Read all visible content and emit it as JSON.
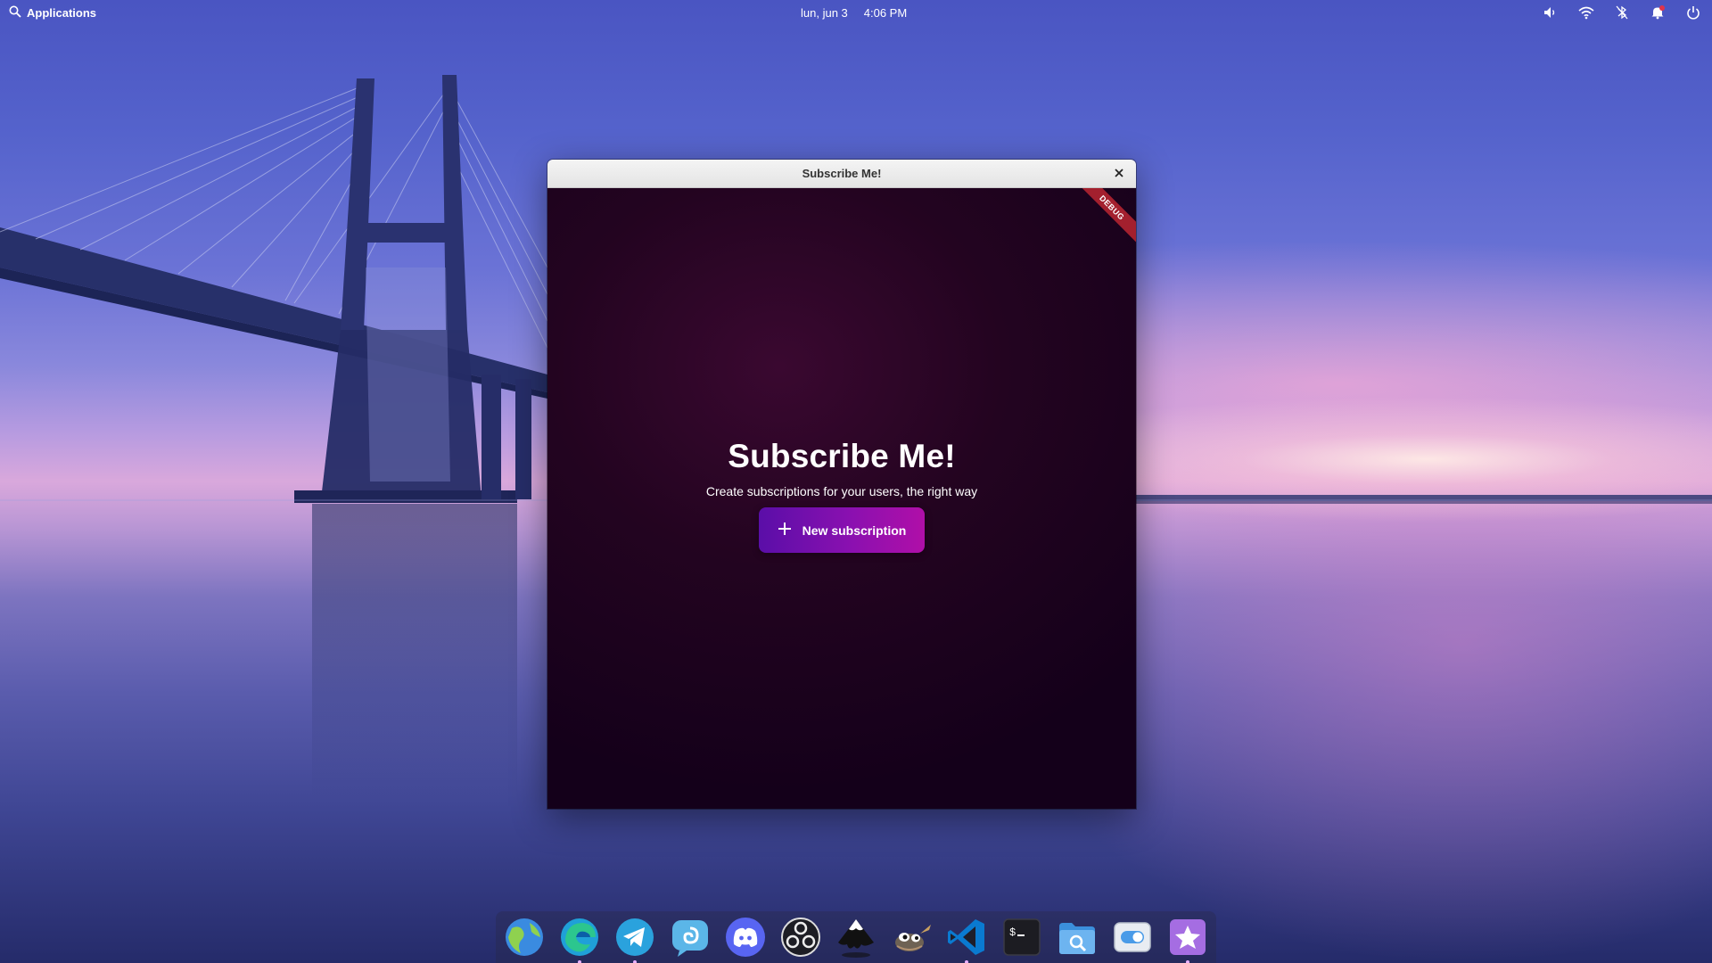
{
  "topbar": {
    "applications_label": "Applications",
    "date": "lun, jun 3",
    "time": "4:06 PM",
    "tray_icons": [
      "volume-icon",
      "wifi-icon",
      "bluetooth-off-icon",
      "notifications-icon",
      "power-icon"
    ]
  },
  "window": {
    "title": "Subscribe Me!",
    "debug_banner": "DEBUG",
    "heading": "Subscribe Me!",
    "subtitle": "Create subscriptions for your users, the right way",
    "new_button_label": "New subscription"
  },
  "dock": {
    "apps": [
      "Web",
      "Microsoft Edge",
      "Telegram",
      "Tootle",
      "Discord",
      "OBS Studio",
      "Inkscape",
      "GIMP",
      "Visual Studio Code",
      "Terminal",
      "Files",
      "System Settings",
      "AppCenter"
    ],
    "icons": [
      "browser-globe-icon",
      "edge-icon",
      "telegram-icon",
      "mastodon-client-icon",
      "discord-icon",
      "obs-icon",
      "inkscape-icon",
      "gimp-icon",
      "vscode-icon",
      "terminal-icon",
      "files-icon",
      "settings-toggle-icon",
      "appcenter-star-icon"
    ]
  },
  "colors": {
    "window_bg": "#14001a",
    "button_gradient_start": "#5a0ea8",
    "button_gradient_end": "#b00fa8",
    "debug_banner": "#a3202e"
  }
}
